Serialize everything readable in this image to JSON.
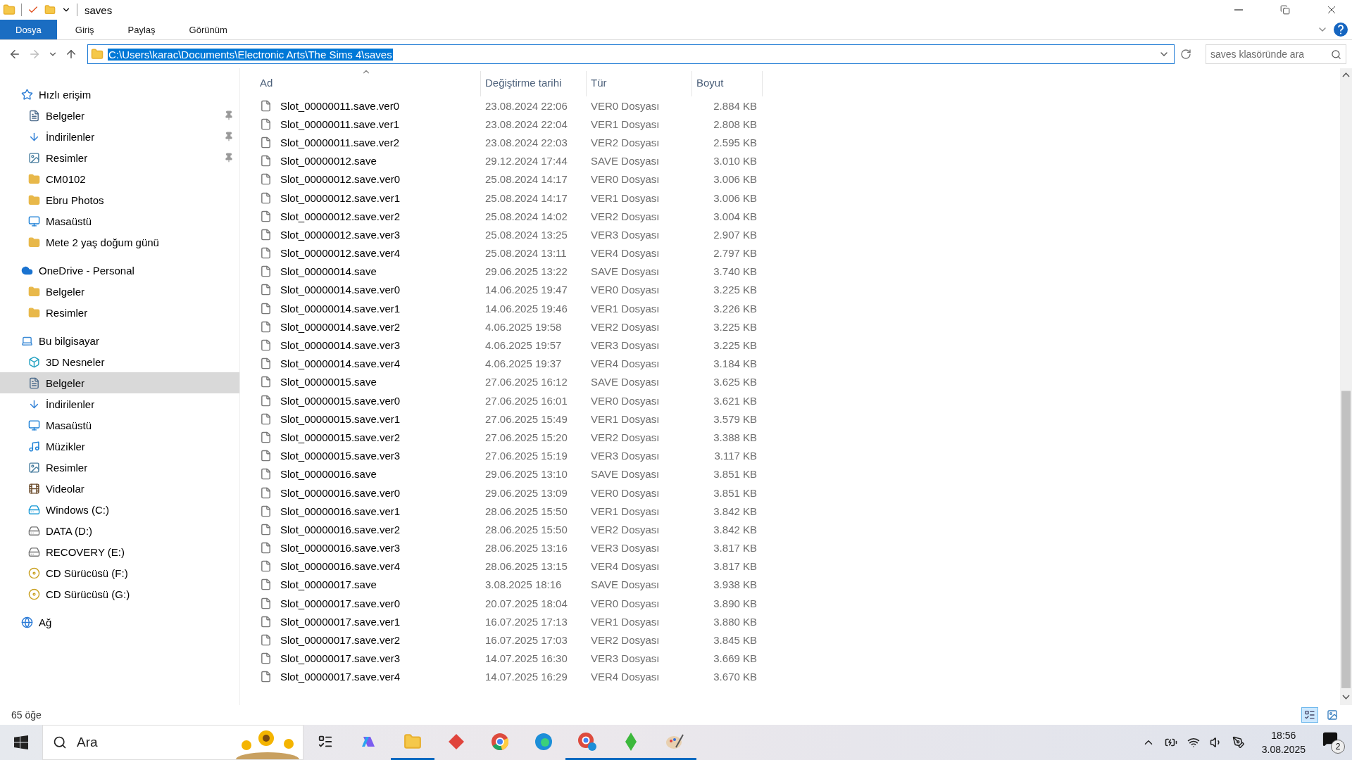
{
  "window": {
    "title": "saves"
  },
  "ribbon_tabs": [
    {
      "label": "Dosya",
      "selected": true
    },
    {
      "label": "Giriş",
      "selected": false
    },
    {
      "label": "Paylaş",
      "selected": false
    },
    {
      "label": "Görünüm",
      "selected": false
    }
  ],
  "address": {
    "value": "C:\\Users\\karac\\Documents\\Electronic Arts\\The Sims 4\\saves"
  },
  "search": {
    "placeholder": "saves klasöründe ara"
  },
  "sidebar": [
    {
      "label": "Hızlı erişim",
      "kind": "star",
      "selected": false,
      "children": [
        {
          "label": "Belgeler",
          "kind": "document",
          "selected": false,
          "pinned": true
        },
        {
          "label": "İndirilenler",
          "kind": "download",
          "selected": false,
          "pinned": true
        },
        {
          "label": "Resimler",
          "kind": "picture",
          "selected": false,
          "pinned": true
        },
        {
          "label": "CM0102",
          "kind": "folder",
          "selected": false,
          "pinned": false
        },
        {
          "label": "Ebru Photos",
          "kind": "folder",
          "selected": false,
          "pinned": false
        },
        {
          "label": "Masaüstü",
          "kind": "desktop",
          "selected": false,
          "pinned": false
        },
        {
          "label": "Mete 2 yaş doğum günü",
          "kind": "folder",
          "selected": false,
          "pinned": false
        }
      ]
    },
    {
      "label": "OneDrive - Personal",
      "kind": "cloud",
      "selected": false,
      "children": [
        {
          "label": "Belgeler",
          "kind": "folder",
          "selected": false,
          "pinned": false
        },
        {
          "label": "Resimler",
          "kind": "folder",
          "selected": false,
          "pinned": false
        }
      ]
    },
    {
      "label": "Bu bilgisayar",
      "kind": "computer",
      "selected": false,
      "children": [
        {
          "label": "3D Nesneler",
          "kind": "cube",
          "selected": false,
          "pinned": false
        },
        {
          "label": "Belgeler",
          "kind": "document",
          "selected": true,
          "pinned": false
        },
        {
          "label": "İndirilenler",
          "kind": "download",
          "selected": false,
          "pinned": false
        },
        {
          "label": "Masaüstü",
          "kind": "desktop",
          "selected": false,
          "pinned": false
        },
        {
          "label": "Müzikler",
          "kind": "music",
          "selected": false,
          "pinned": false
        },
        {
          "label": "Resimler",
          "kind": "picture",
          "selected": false,
          "pinned": false
        },
        {
          "label": "Videolar",
          "kind": "video",
          "selected": false,
          "pinned": false
        },
        {
          "label": "Windows (C:)",
          "kind": "system-drive",
          "selected": false,
          "pinned": false
        },
        {
          "label": "DATA (D:)",
          "kind": "drive",
          "selected": false,
          "pinned": false
        },
        {
          "label": "RECOVERY (E:)",
          "kind": "drive",
          "selected": false,
          "pinned": false
        },
        {
          "label": "CD Sürücüsü (F:)",
          "kind": "cd",
          "selected": false,
          "pinned": false
        },
        {
          "label": "CD Sürücüsü (G:)",
          "kind": "cd",
          "selected": false,
          "pinned": false
        }
      ]
    },
    {
      "label": "Ağ",
      "kind": "network",
      "selected": false
    }
  ],
  "table": {
    "columns": [
      "Ad",
      "Değiştirme tarihi",
      "Tür",
      "Boyut"
    ],
    "rows": [
      {
        "name": "Slot_00000011.save.ver0",
        "date": "23.08.2024 22:06",
        "type": "VER0 Dosyası",
        "size": "2.884 KB"
      },
      {
        "name": "Slot_00000011.save.ver1",
        "date": "23.08.2024 22:04",
        "type": "VER1 Dosyası",
        "size": "2.808 KB"
      },
      {
        "name": "Slot_00000011.save.ver2",
        "date": "23.08.2024 22:03",
        "type": "VER2 Dosyası",
        "size": "2.595 KB"
      },
      {
        "name": "Slot_00000012.save",
        "date": "29.12.2024 17:44",
        "type": "SAVE Dosyası",
        "size": "3.010 KB"
      },
      {
        "name": "Slot_00000012.save.ver0",
        "date": "25.08.2024 14:17",
        "type": "VER0 Dosyası",
        "size": "3.006 KB"
      },
      {
        "name": "Slot_00000012.save.ver1",
        "date": "25.08.2024 14:17",
        "type": "VER1 Dosyası",
        "size": "3.006 KB"
      },
      {
        "name": "Slot_00000012.save.ver2",
        "date": "25.08.2024 14:02",
        "type": "VER2 Dosyası",
        "size": "3.004 KB"
      },
      {
        "name": "Slot_00000012.save.ver3",
        "date": "25.08.2024 13:25",
        "type": "VER3 Dosyası",
        "size": "2.907 KB"
      },
      {
        "name": "Slot_00000012.save.ver4",
        "date": "25.08.2024 13:11",
        "type": "VER4 Dosyası",
        "size": "2.797 KB"
      },
      {
        "name": "Slot_00000014.save",
        "date": "29.06.2025 13:22",
        "type": "SAVE Dosyası",
        "size": "3.740 KB"
      },
      {
        "name": "Slot_00000014.save.ver0",
        "date": "14.06.2025 19:47",
        "type": "VER0 Dosyası",
        "size": "3.225 KB"
      },
      {
        "name": "Slot_00000014.save.ver1",
        "date": "14.06.2025 19:46",
        "type": "VER1 Dosyası",
        "size": "3.226 KB"
      },
      {
        "name": "Slot_00000014.save.ver2",
        "date": "4.06.2025 19:58",
        "type": "VER2 Dosyası",
        "size": "3.225 KB"
      },
      {
        "name": "Slot_00000014.save.ver3",
        "date": "4.06.2025 19:57",
        "type": "VER3 Dosyası",
        "size": "3.225 KB"
      },
      {
        "name": "Slot_00000014.save.ver4",
        "date": "4.06.2025 19:37",
        "type": "VER4 Dosyası",
        "size": "3.184 KB"
      },
      {
        "name": "Slot_00000015.save",
        "date": "27.06.2025 16:12",
        "type": "SAVE Dosyası",
        "size": "3.625 KB"
      },
      {
        "name": "Slot_00000015.save.ver0",
        "date": "27.06.2025 16:01",
        "type": "VER0 Dosyası",
        "size": "3.621 KB"
      },
      {
        "name": "Slot_00000015.save.ver1",
        "date": "27.06.2025 15:49",
        "type": "VER1 Dosyası",
        "size": "3.579 KB"
      },
      {
        "name": "Slot_00000015.save.ver2",
        "date": "27.06.2025 15:20",
        "type": "VER2 Dosyası",
        "size": "3.388 KB"
      },
      {
        "name": "Slot_00000015.save.ver3",
        "date": "27.06.2025 15:19",
        "type": "VER3 Dosyası",
        "size": "3.117 KB"
      },
      {
        "name": "Slot_00000016.save",
        "date": "29.06.2025 13:10",
        "type": "SAVE Dosyası",
        "size": "3.851 KB"
      },
      {
        "name": "Slot_00000016.save.ver0",
        "date": "29.06.2025 13:09",
        "type": "VER0 Dosyası",
        "size": "3.851 KB"
      },
      {
        "name": "Slot_00000016.save.ver1",
        "date": "28.06.2025 15:50",
        "type": "VER1 Dosyası",
        "size": "3.842 KB"
      },
      {
        "name": "Slot_00000016.save.ver2",
        "date": "28.06.2025 15:50",
        "type": "VER2 Dosyası",
        "size": "3.842 KB"
      },
      {
        "name": "Slot_00000016.save.ver3",
        "date": "28.06.2025 13:16",
        "type": "VER3 Dosyası",
        "size": "3.817 KB"
      },
      {
        "name": "Slot_00000016.save.ver4",
        "date": "28.06.2025 13:15",
        "type": "VER4 Dosyası",
        "size": "3.817 KB"
      },
      {
        "name": "Slot_00000017.save",
        "date": "3.08.2025 18:16",
        "type": "SAVE Dosyası",
        "size": "3.938 KB"
      },
      {
        "name": "Slot_00000017.save.ver0",
        "date": "20.07.2025 18:04",
        "type": "VER0 Dosyası",
        "size": "3.890 KB"
      },
      {
        "name": "Slot_00000017.save.ver1",
        "date": "16.07.2025 17:13",
        "type": "VER1 Dosyası",
        "size": "3.880 KB"
      },
      {
        "name": "Slot_00000017.save.ver2",
        "date": "16.07.2025 17:03",
        "type": "VER2 Dosyası",
        "size": "3.845 KB"
      },
      {
        "name": "Slot_00000017.save.ver3",
        "date": "14.07.2025 16:30",
        "type": "VER3 Dosyası",
        "size": "3.669 KB"
      },
      {
        "name": "Slot_00000017.save.ver4",
        "date": "14.07.2025 16:29",
        "type": "VER4 Dosyası",
        "size": "3.670 KB"
      }
    ]
  },
  "status_bar": {
    "item_count": "65 öğe",
    "views": [
      {
        "kind": "details",
        "selected": true
      },
      {
        "kind": "large-icons",
        "selected": false
      }
    ]
  },
  "taskbar": {
    "search_placeholder": "Ara",
    "apps": [
      {
        "kind": "task-view",
        "running": false
      },
      {
        "kind": "copilot",
        "running": false
      },
      {
        "kind": "explorer",
        "running": true
      },
      {
        "kind": "game",
        "running": false
      },
      {
        "kind": "chrome",
        "running": false
      },
      {
        "kind": "edge",
        "running": false
      },
      {
        "kind": "chrome-edge",
        "running": true
      },
      {
        "kind": "plumbob",
        "running": true
      },
      {
        "kind": "paint",
        "running": true
      }
    ],
    "time": "18:56",
    "date": "3.08.2025",
    "notifications": "2"
  }
}
